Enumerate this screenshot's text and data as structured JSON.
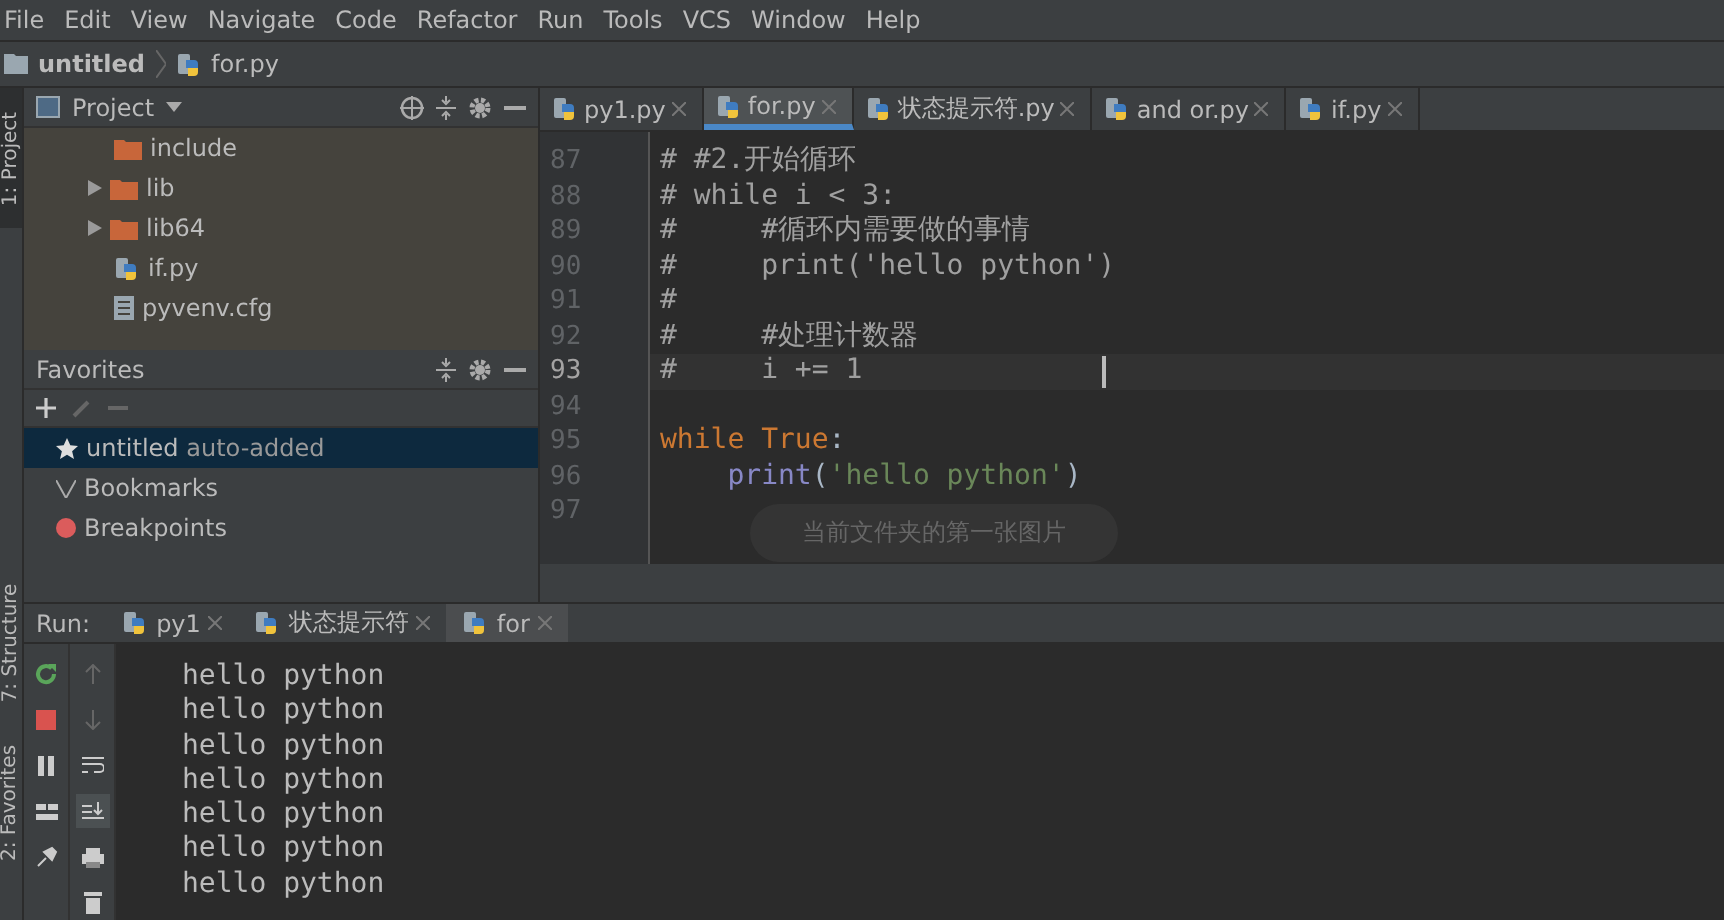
{
  "menu": [
    "File",
    "Edit",
    "View",
    "Navigate",
    "Code",
    "Refactor",
    "Run",
    "Tools",
    "VCS",
    "Window",
    "Help"
  ],
  "breadcrumb": [
    "untitled",
    "for.py"
  ],
  "side_tabs": [
    {
      "label": "1: Project",
      "selected": true
    },
    {
      "label": "7: Structure",
      "selected": false
    },
    {
      "label": "2: Favorites",
      "selected": false
    }
  ],
  "project_panel": {
    "title": "Project",
    "tree": [
      {
        "label": "include",
        "kind": "folder"
      },
      {
        "label": "lib",
        "kind": "folder",
        "expanded": false
      },
      {
        "label": "lib64",
        "kind": "folder",
        "expanded": false
      },
      {
        "label": "if.py",
        "kind": "python"
      },
      {
        "label": "pyvenv.cfg",
        "kind": "text"
      }
    ]
  },
  "favorites": {
    "title": "Favorites",
    "items": [
      {
        "label": "untitled",
        "note": "auto-added",
        "kind": "star",
        "selected": true
      },
      {
        "label": "Bookmarks",
        "kind": "check",
        "selected": false
      },
      {
        "label": "Breakpoints",
        "kind": "dot",
        "selected": false
      }
    ]
  },
  "editor": {
    "tabs": [
      {
        "label": "py1.py",
        "selected": false
      },
      {
        "label": "for.py",
        "selected": true
      },
      {
        "label": "状态提示符.py",
        "selected": false
      },
      {
        "label": "and or.py",
        "selected": false
      },
      {
        "label": "if.py",
        "selected": false
      }
    ],
    "lines": [
      {
        "number": "87",
        "current": false,
        "tokens": [
          {
            "text": "# #2.开始循环",
            "kind": "comment"
          }
        ]
      },
      {
        "number": "88",
        "current": false,
        "tokens": [
          {
            "text": "# while i < 3:",
            "kind": "comment"
          }
        ]
      },
      {
        "number": "89",
        "current": false,
        "tokens": [
          {
            "text": "#     #循环内需要做的事情",
            "kind": "comment"
          }
        ]
      },
      {
        "number": "90",
        "current": false,
        "tokens": [
          {
            "text": "#     print('hello python')",
            "kind": "comment"
          }
        ]
      },
      {
        "number": "91",
        "current": false,
        "tokens": [
          {
            "text": "#",
            "kind": "comment"
          }
        ]
      },
      {
        "number": "92",
        "current": false,
        "tokens": [
          {
            "text": "#     #处理计数器",
            "kind": "comment"
          }
        ]
      },
      {
        "number": "93",
        "current": true,
        "tokens": [
          {
            "text": "#     i += 1",
            "kind": "comment"
          }
        ]
      },
      {
        "number": "94",
        "current": false
      },
      {
        "number": "95",
        "current": false,
        "tokens": [
          {
            "text": "while True",
            "kind": "keyword"
          },
          {
            "text": ":",
            "kind": "plain"
          }
        ]
      },
      {
        "number": "96",
        "current": false,
        "tokens": [
          {
            "text": "    print",
            "kind": "builtin"
          },
          {
            "text": "(",
            "kind": "plain"
          },
          {
            "text": "'hello python'",
            "kind": "string"
          },
          {
            "text": ")",
            "kind": "plain"
          }
        ]
      },
      {
        "number": "97",
        "current": false
      }
    ]
  },
  "toast": "当前文件夹的第一张图片",
  "run_panel": {
    "label": "Run:",
    "tabs": [
      {
        "label": "py1",
        "selected": false
      },
      {
        "label": "状态提示符",
        "selected": false
      },
      {
        "label": "for",
        "selected": true
      }
    ],
    "output": [
      "hello python",
      "hello python",
      "hello python",
      "hello python",
      "hello python",
      "hello python",
      "hello python"
    ]
  }
}
